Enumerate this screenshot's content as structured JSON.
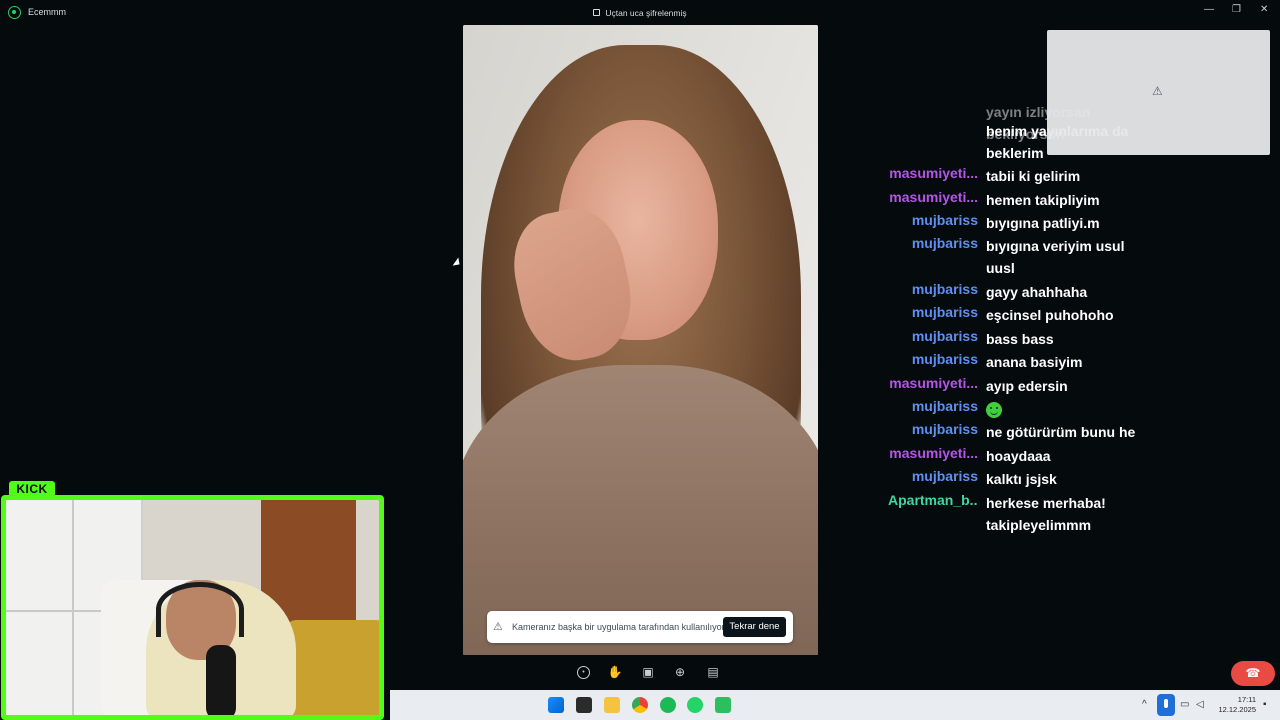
{
  "window": {
    "app_name": "Ecemmm",
    "encryption_notice": "Uçtan uca şifrelenmiş",
    "controls": [
      "—",
      "❐",
      "✕"
    ]
  },
  "call": {
    "camera_warning": "Kameranız başka bir uygulama tarafından kullanılıyor.",
    "retry_label": "Tekrar dene",
    "controls": [
      "emoji-icon",
      "raise-hand-icon",
      "screen-share-icon",
      "add-person-icon",
      "more-icon"
    ],
    "end_call_icon": "phone-hangup-icon"
  },
  "chat": {
    "partial_message": [
      "yayın izliyorsan bekliyorsun",
      "benim yayınlarıma da",
      "beklerim"
    ],
    "messages": [
      {
        "user": "masumiyeti...",
        "color": "#b455e8",
        "text": "tabii ki gelirim"
      },
      {
        "user": "masumiyeti...",
        "color": "#b455e8",
        "text": "hemen takipliyim"
      },
      {
        "user": "mujbariss",
        "color": "#5f8ff0",
        "text": "bıyıgına patliyi.m"
      },
      {
        "user": "mujbariss",
        "color": "#5f8ff0",
        "text": "bıyıgına veriyim usul uusl"
      },
      {
        "user": "mujbariss",
        "color": "#5f8ff0",
        "text": "gayy ahahhaha"
      },
      {
        "user": "mujbariss",
        "color": "#5f8ff0",
        "text": "eşcinsel puhohoho"
      },
      {
        "user": "mujbariss",
        "color": "#5f8ff0",
        "text": "bass bass"
      },
      {
        "user": "mujbariss",
        "color": "#5f8ff0",
        "text": "anana basiyim"
      },
      {
        "user": "masumiyeti...",
        "color": "#b455e8",
        "text": "ayıp edersin"
      },
      {
        "user": "mujbariss",
        "color": "#5f8ff0",
        "text": ""
      },
      {
        "user": "mujbariss",
        "color": "#5f8ff0",
        "text": "ne götürürüm bunu he"
      },
      {
        "user": "masumiyeti...",
        "color": "#b455e8",
        "text": "hoaydaaa"
      },
      {
        "user": "mujbariss",
        "color": "#5f8ff0",
        "text": "kalktı jsjsk"
      },
      {
        "user": "Apartman_b...",
        "color": "#3fd6a1",
        "text": "herkese merhaba! takipleyelimmm"
      }
    ]
  },
  "stream": {
    "badge": "KICK",
    "badge_color": "#53fc18"
  },
  "taskbar": {
    "icons": [
      "windows-start-icon",
      "task-view-icon",
      "file-explorer-icon",
      "chrome-icon",
      "spotify-icon",
      "whatsapp-icon",
      "terminal-icon"
    ],
    "time": "17:11",
    "date": "12.12.2025"
  }
}
